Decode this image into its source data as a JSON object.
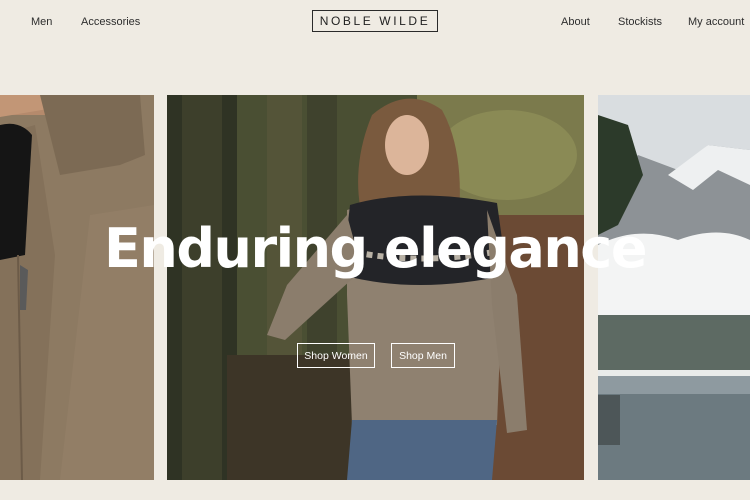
{
  "nav": {
    "left": [
      {
        "label": "Men"
      },
      {
        "label": "Accessories"
      }
    ],
    "right": [
      {
        "label": "About"
      },
      {
        "label": "Stockists"
      },
      {
        "label": "My account"
      }
    ]
  },
  "brand": {
    "logo_text": "NOBLE WILDE"
  },
  "hero": {
    "headline": "Enduring elegance",
    "buttons": [
      {
        "label": "Shop Women"
      },
      {
        "label": "Shop Men"
      }
    ]
  },
  "colors": {
    "background": "#efebe3",
    "text": "#2b2b2b",
    "hero_text": "#ffffff"
  }
}
